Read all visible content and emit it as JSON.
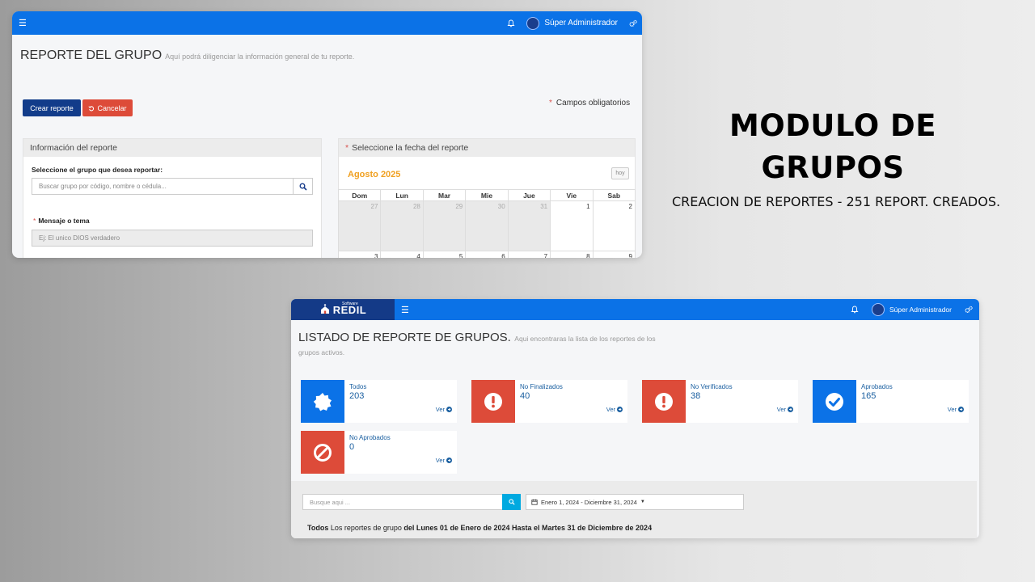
{
  "hero": {
    "title": "MODULO DE GRUPOS",
    "subtitle": "CREACION DE REPORTES - 251 REPORT. CREADOS."
  },
  "shot1": {
    "topbar": {
      "menu_icon": "hamburger-icon",
      "bell_icon": "bell-icon",
      "user": "Súper Administrador",
      "settings_icon": "gears-icon"
    },
    "title": "REPORTE DEL GRUPO",
    "subtitle": "Aquí podrá diligenciar la información general de tu reporte.",
    "create_button": "Crear reporte",
    "cancel_button": "Cancelar",
    "required_note": "Campos obligatorios",
    "info_panel": {
      "heading": "Información del reporte",
      "group_label": "Seleccione el grupo que desea reportar:",
      "group_placeholder": "Buscar grupo por código, nombre o cédula...",
      "message_label": "Mensaje o tema",
      "message_placeholder": "Ej: El unico DIOS verdadero"
    },
    "calendar": {
      "heading": "Seleccione la fecha del reporte",
      "month": "Agosto 2025",
      "today_button": "hoy",
      "weekdays": [
        "Dom",
        "Lun",
        "Mar",
        "Mie",
        "Jue",
        "Vie",
        "Sab"
      ],
      "week1": [
        "27",
        "28",
        "29",
        "30",
        "31",
        "1",
        "2"
      ],
      "week2": [
        "3",
        "4",
        "5",
        "6",
        "7",
        "8",
        "9"
      ]
    }
  },
  "shot2": {
    "brand": {
      "small": "Software",
      "name": "REDIL"
    },
    "topbar": {
      "user": "Súper Administrador"
    },
    "title": "LISTADO DE REPORTE DE GRUPOS.",
    "subtitle": "Aqui encontraras la lista de los reportes de los grupos activos.",
    "stats": [
      {
        "name": "Todos",
        "value": "203",
        "link": "Ver",
        "icon": "badge-icon",
        "color": "#0b72e7"
      },
      {
        "name": "No Finalizados",
        "value": "40",
        "link": "Ver",
        "icon": "exclamation-icon",
        "color": "#dd4b39"
      },
      {
        "name": "No Verificados",
        "value": "38",
        "link": "Ver",
        "icon": "exclamation-icon",
        "color": "#dd4b39"
      },
      {
        "name": "Aprobados",
        "value": "165",
        "link": "Ver",
        "icon": "check-icon",
        "color": "#0b72e7"
      },
      {
        "name": "No Aprobados",
        "value": "0",
        "link": "Ver",
        "icon": "ban-icon",
        "color": "#dd4b39"
      }
    ],
    "search_placeholder": "Busque aqui ...",
    "date_range": "Enero 1, 2024 - Diciembre 31, 2024",
    "summary": {
      "lead": "Todos",
      "text": "Los reportes de grupo",
      "range": "del Lunes 01 de Enero de 2024 Hasta el Martes 31 de Diciembre de 2024"
    }
  }
}
